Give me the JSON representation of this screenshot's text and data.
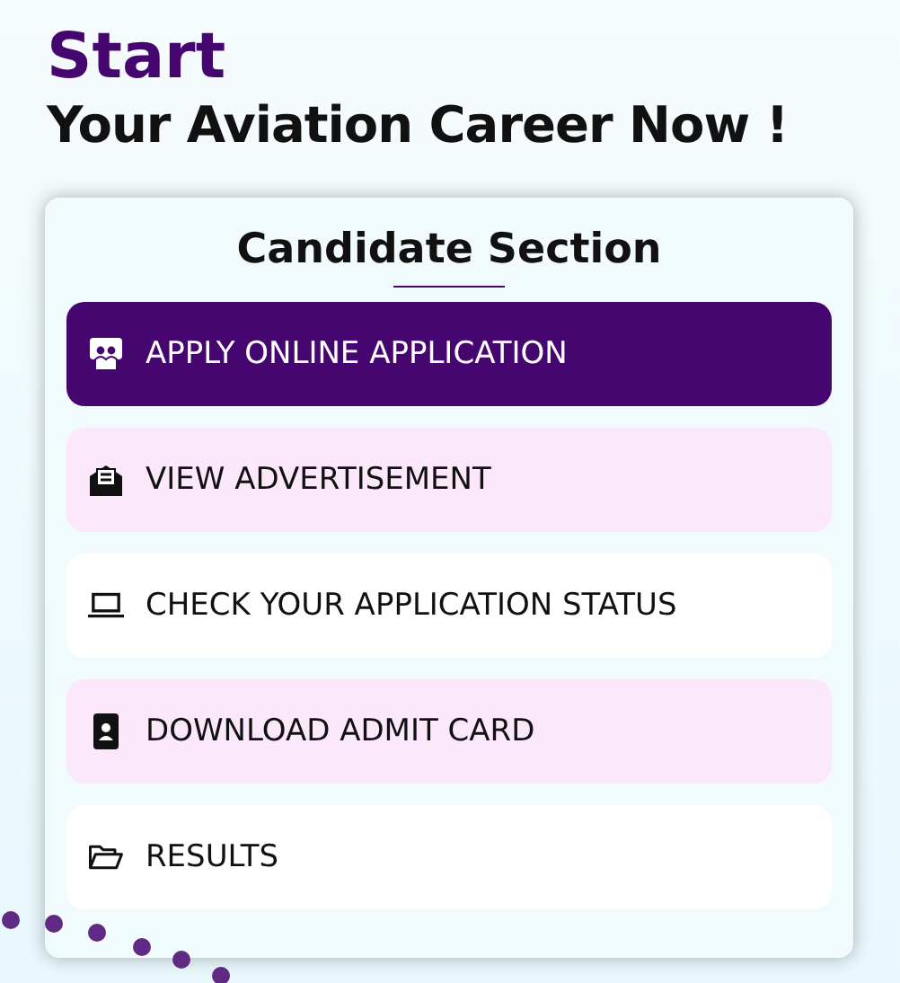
{
  "headline": {
    "line_1": "Start",
    "line_2": "Your Aviation Career Now !"
  },
  "card": {
    "title": "Candidate Section",
    "items": [
      {
        "label": "APPLY ONLINE APPLICATION",
        "kind": "people",
        "selected": true,
        "color": "#46066f"
      },
      {
        "label": "VIEW ADVERTISEMENT",
        "kind": "envelope",
        "selected": false,
        "color": "#fbe8fb"
      },
      {
        "label": "CHECK YOUR APPLICATION STATUS",
        "kind": "laptop",
        "selected": false,
        "color": "#ffffff"
      },
      {
        "label": "DOWNLOAD ADMIT CARD",
        "kind": "idcard",
        "selected": false,
        "color": "#fbe8fb"
      },
      {
        "label": "RESULTS",
        "kind": "folder",
        "selected": false,
        "color": "#ffffff"
      }
    ]
  }
}
